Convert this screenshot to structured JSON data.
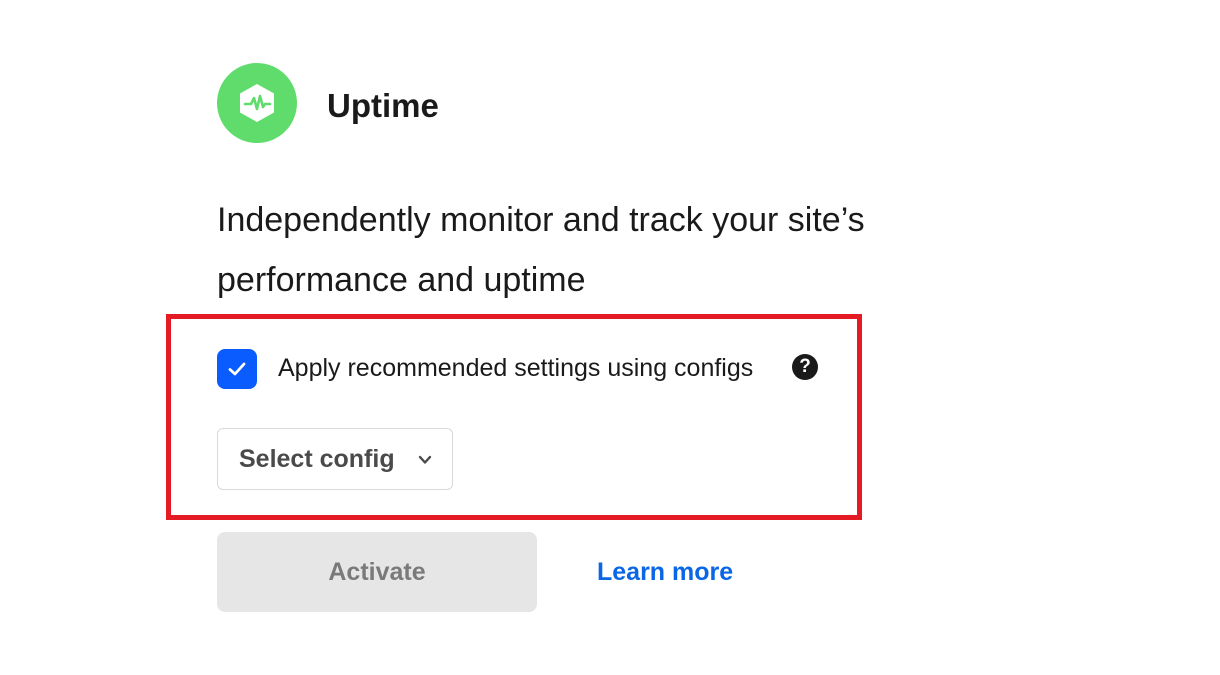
{
  "colors": {
    "logo_green": "#5fdc6b",
    "checkbox_blue": "#0b5cff",
    "highlight_red": "#e41b23",
    "link_blue": "#0a66e4"
  },
  "header": {
    "logo_icon": "uptime-pulse-hexagon-icon",
    "title": "Uptime"
  },
  "description": "Independently monitor and track your site’s performance and uptime",
  "config": {
    "checkbox_checked": true,
    "checkbox_label": "Apply recommended settings using configs",
    "help_icon": "question-circle-icon",
    "help_glyph": "?",
    "select_label": "Select config"
  },
  "actions": {
    "activate_label": "Activate",
    "learn_more_label": "Learn more"
  }
}
